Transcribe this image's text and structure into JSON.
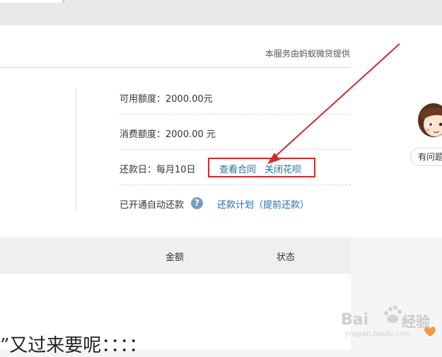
{
  "provider_note": "本服务由蚂蚁微贷提供",
  "credit": {
    "available_label": "可用额度：",
    "available_value": "2000.00元",
    "consumption_label": "消费额度：",
    "consumption_value": "2000.00 元",
    "repay_day_label": "还款日：每月10日",
    "view_contract": "查看合同",
    "close_huabei": "关闭花呗",
    "auto_repay_label": "已开通自动还款",
    "help_icon": "?",
    "repay_plan": "还款计划（提前还款）"
  },
  "table_header": {
    "amount": "金额",
    "status": "状态"
  },
  "content_text": "”又过来要呢：：：：",
  "help_chip": "有问题",
  "watermark": {
    "brand": "Bai",
    "text": "经验",
    "url": "jingyan.baidu.com"
  },
  "colors": {
    "link": "#1f6fa8",
    "highlight": "#d22b2b",
    "help_icon": "#7b9cc0"
  }
}
